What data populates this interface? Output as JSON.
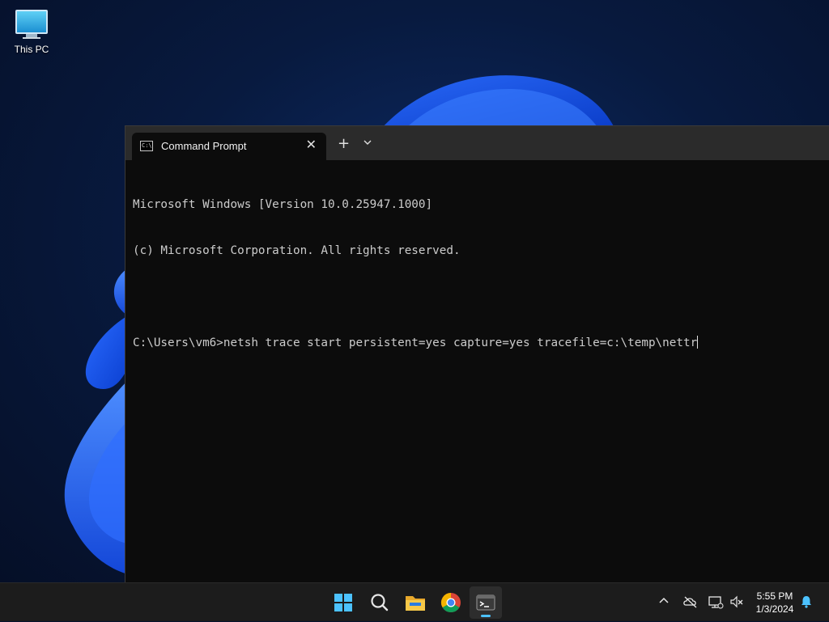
{
  "desktop": {
    "icons": [
      {
        "label": "This PC",
        "icon": "this-pc-icon"
      }
    ]
  },
  "window": {
    "tab_title": "Command Prompt",
    "tab_icon": "cmd-icon",
    "new_tab_symbol": "+",
    "dropdown_symbol": "⌄",
    "close_symbol": "✕"
  },
  "console": {
    "lines": [
      "Microsoft Windows [Version 10.0.25947.1000]",
      "(c) Microsoft Corporation. All rights reserved.",
      "",
      "C:\\Users\\vm6>netsh trace start persistent=yes capture=yes tracefile=c:\\temp\\nettr"
    ]
  },
  "taskbar": {
    "apps": [
      "start-icon",
      "search-icon",
      "file-explorer-icon",
      "chrome-icon",
      "terminal-icon"
    ],
    "active_app": "terminal-icon",
    "tray": {
      "time": "5:55 PM",
      "date": "1/3/2024"
    }
  },
  "colors": {
    "accent": "#4cc2ff",
    "terminal_bg": "#0c0c0c",
    "taskbar_bg": "#1c1c1c"
  }
}
